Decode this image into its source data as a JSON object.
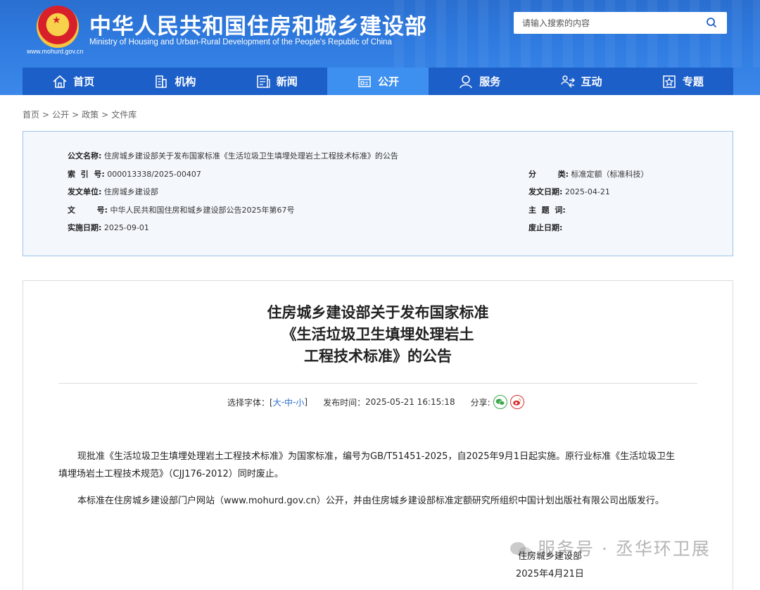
{
  "header": {
    "title": "中华人民共和国住房和城乡建设部",
    "subtitle": "Ministry of Housing and Urban-Rural Development of the People's Republic of China",
    "site_url": "www.mohurd.gov.cn",
    "search_placeholder": "请输入搜索的内容",
    "brand_color": "#2f7be0"
  },
  "nav": {
    "items": [
      {
        "label": "首页",
        "icon": "home-icon"
      },
      {
        "label": "机构",
        "icon": "building-icon"
      },
      {
        "label": "新闻",
        "icon": "news-icon"
      },
      {
        "label": "公开",
        "icon": "disclosure-icon",
        "active": true
      },
      {
        "label": "服务",
        "icon": "service-icon"
      },
      {
        "label": "互动",
        "icon": "interaction-icon"
      },
      {
        "label": "专题",
        "icon": "topic-icon"
      }
    ]
  },
  "breadcrumb": [
    "首页",
    "公开",
    "政策",
    "文件库"
  ],
  "info": {
    "doc_name_label": "公文名称:",
    "doc_name": "住房城乡建设部关于发布国家标准《生活垃圾卫生填埋处理岩土工程技术标准》的公告",
    "index_label": "索  引  号:",
    "index": "000013338/2025-00407",
    "category_label": "分        类:",
    "category": "标准定额（标准科技）",
    "issuer_label": "发文单位:",
    "issuer": "住房城乡建设部",
    "issue_date_label": "发文日期:",
    "issue_date": "2025-04-21",
    "doc_no_label": "文        号:",
    "doc_no": "中华人民共和国住房和城乡建设部公告2025年第67号",
    "keywords_label": "主  题  词:",
    "keywords": "",
    "effective_label": "实施日期:",
    "effective": "2025-09-01",
    "abolish_label": "废止日期:",
    "abolish": ""
  },
  "article": {
    "title_line1": "住房城乡建设部关于发布国家标准",
    "title_line2": "《生活垃圾卫生填埋处理岩土",
    "title_line3": "工程技术标准》的公告",
    "font_choice_label": "选择字体：[",
    "font_large": "大",
    "font_medium": "中",
    "font_small": "小",
    "font_choice_end": "]",
    "publish_label": "发布时间：",
    "publish_time": "2025-05-21 16:15:18",
    "share_label": "分享:",
    "para1_line1": "现批准《生活垃圾卫生填埋处理岩土工程技术标准》为国家标准，编号为GB/T51451-2025，自2025年9月1日起实施。原行业标准《生活垃圾卫生",
    "para1_line2": "填埋场岩土工程技术规范》（CJJ176-2012）同时废止。",
    "para2": "本标准在住房城乡建设部门户网站（www.mohurd.gov.cn）公开，并由住房城乡建设部标准定额研究所组织中国计划出版社有限公司出版发行。",
    "signer": "住房城乡建设部",
    "sign_date": "2025年4月21日"
  },
  "watermark": "服务号 · 丞华环卫展"
}
